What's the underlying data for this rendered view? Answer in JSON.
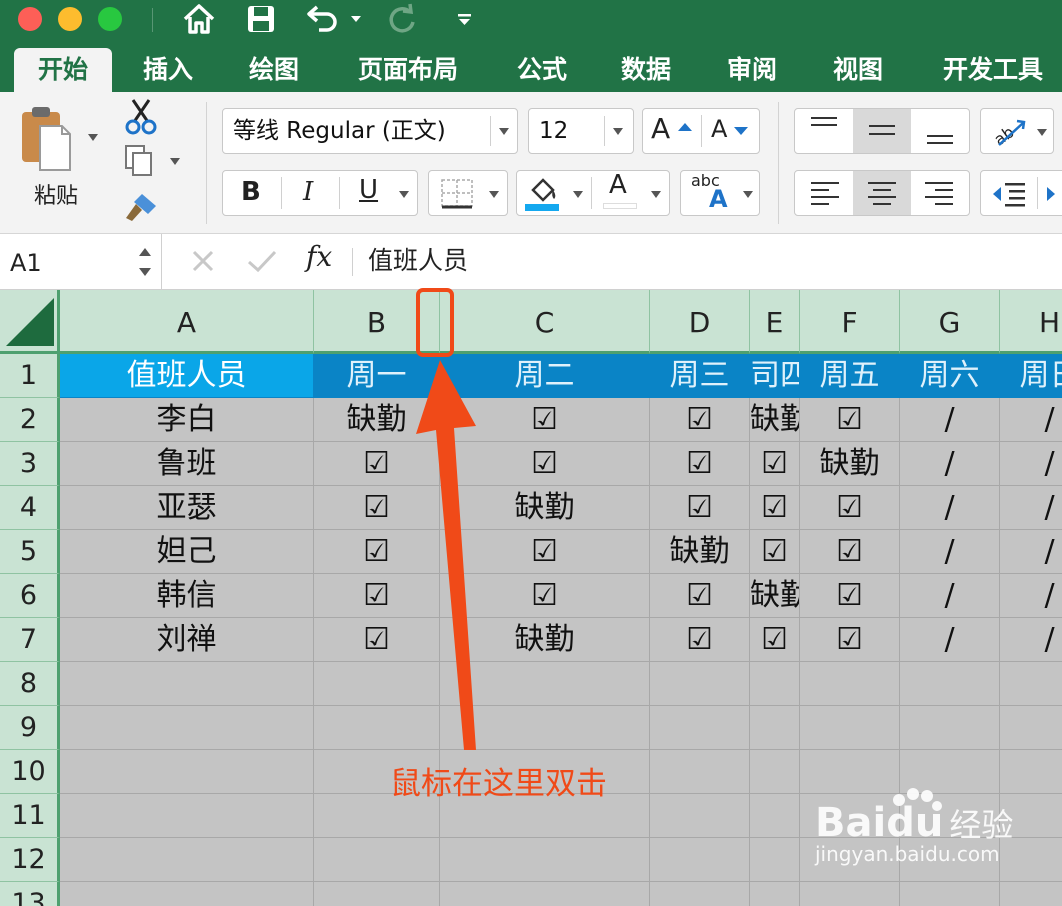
{
  "quick_access": {
    "icons": [
      "home-icon",
      "save-icon",
      "undo-icon",
      "redo-icon",
      "customize-icon"
    ]
  },
  "tabs": [
    {
      "label": "开始",
      "active": true
    },
    {
      "label": "插入"
    },
    {
      "label": "绘图"
    },
    {
      "label": "页面布局"
    },
    {
      "label": "公式"
    },
    {
      "label": "数据"
    },
    {
      "label": "审阅"
    },
    {
      "label": "视图"
    },
    {
      "label": "开发工具"
    }
  ],
  "ribbon": {
    "paste_label": "粘贴",
    "font_name": "等线 Regular (正文)",
    "font_size": "12",
    "grow_font": "A",
    "shrink_font": "A",
    "bold": "B",
    "italic": "I",
    "underline": "U",
    "font_color_letter": "A",
    "phonetic_text": "abc",
    "phonetic_letter": "A"
  },
  "formula_bar": {
    "name_box": "A1",
    "fx": "fx",
    "content": "值班人员"
  },
  "sheet": {
    "columns": [
      "A",
      "B",
      "C",
      "D",
      "E",
      "F",
      "G",
      "H"
    ],
    "rows": [
      "1",
      "2",
      "3",
      "4",
      "5",
      "6",
      "7",
      "8",
      "9",
      "10",
      "11",
      "12",
      "13"
    ],
    "header_row": [
      "值班人员",
      "周一",
      "周二",
      "周三",
      "司四",
      "周五",
      "周六",
      "周日"
    ],
    "data": [
      [
        "李白",
        "缺勤",
        "☑",
        "☑",
        "缺勤",
        "☑",
        "/",
        "/"
      ],
      [
        "鲁班",
        "☑",
        "☑",
        "☑",
        "☑",
        "缺勤",
        "/",
        "/"
      ],
      [
        "亚瑟",
        "☑",
        "缺勤",
        "☑",
        "☑",
        "☑",
        "/",
        "/"
      ],
      [
        "妲己",
        "☑",
        "☑",
        "缺勤",
        "☑",
        "☑",
        "/",
        "/"
      ],
      [
        "韩信",
        "☑",
        "☑",
        "☑",
        "缺勤",
        "☑",
        "/",
        "/"
      ],
      [
        "刘禅",
        "☑",
        "缺勤",
        "☑",
        "☑",
        "☑",
        "/",
        "/"
      ]
    ]
  },
  "annotation": {
    "text": "鼠标在这里双击"
  },
  "watermark": {
    "brand": "Bai",
    "brand2": "du",
    "suffix": "经验",
    "url": "jingyan.baidu.com"
  },
  "colors": {
    "excel_green": "#217346",
    "header_blue": "#0a84c6",
    "header_blue_first": "#0aa6e8",
    "annotation_red": "#f04a18"
  }
}
